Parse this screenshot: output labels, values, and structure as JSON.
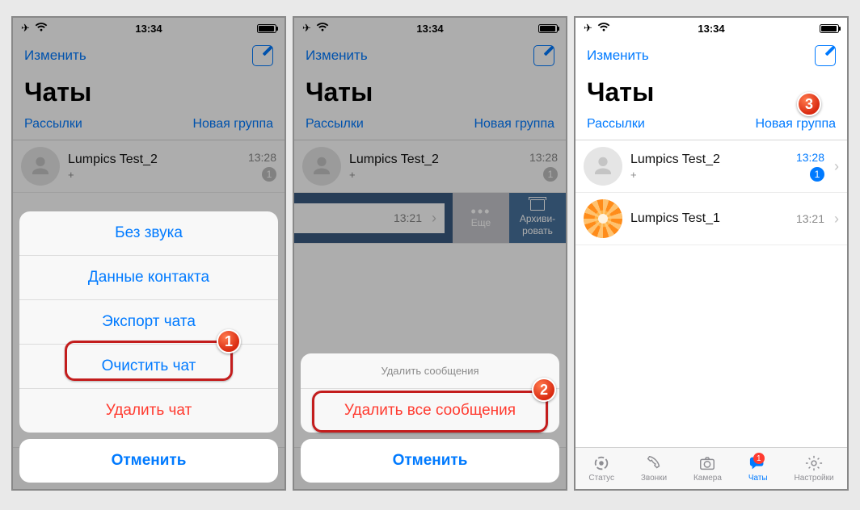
{
  "status": {
    "time": "13:34"
  },
  "nav": {
    "edit": "Изменить"
  },
  "title": "Чаты",
  "sublinks": {
    "broadcasts": "Рассылки",
    "new_group": "Новая группа"
  },
  "chats": [
    {
      "name": "Lumpics Test_2",
      "preview": "+",
      "time": "13:28",
      "unread": "1"
    },
    {
      "name": "Lumpics Test_1",
      "preview": "",
      "time": "13:21"
    }
  ],
  "swiped_partial_name": "Test_1",
  "swipe": {
    "more": "Еще",
    "archive_l1": "Архиви-",
    "archive_l2": "ровать"
  },
  "sheet1": {
    "mute": "Без звука",
    "contact": "Данные контакта",
    "export": "Экспорт чата",
    "clear": "Очистить чат",
    "delete": "Удалить чат",
    "cancel": "Отменить"
  },
  "sheet2": {
    "header": "Удалить сообщения",
    "delete_all": "Удалить все сообщения",
    "cancel": "Отменить"
  },
  "tabs": {
    "status": "Статус",
    "calls": "Звонки",
    "camera": "Камера",
    "chats": "Чаты",
    "settings": "Настройки",
    "chats_badge": "1"
  },
  "badges": {
    "b1": "1",
    "b2": "2",
    "b3": "3"
  }
}
